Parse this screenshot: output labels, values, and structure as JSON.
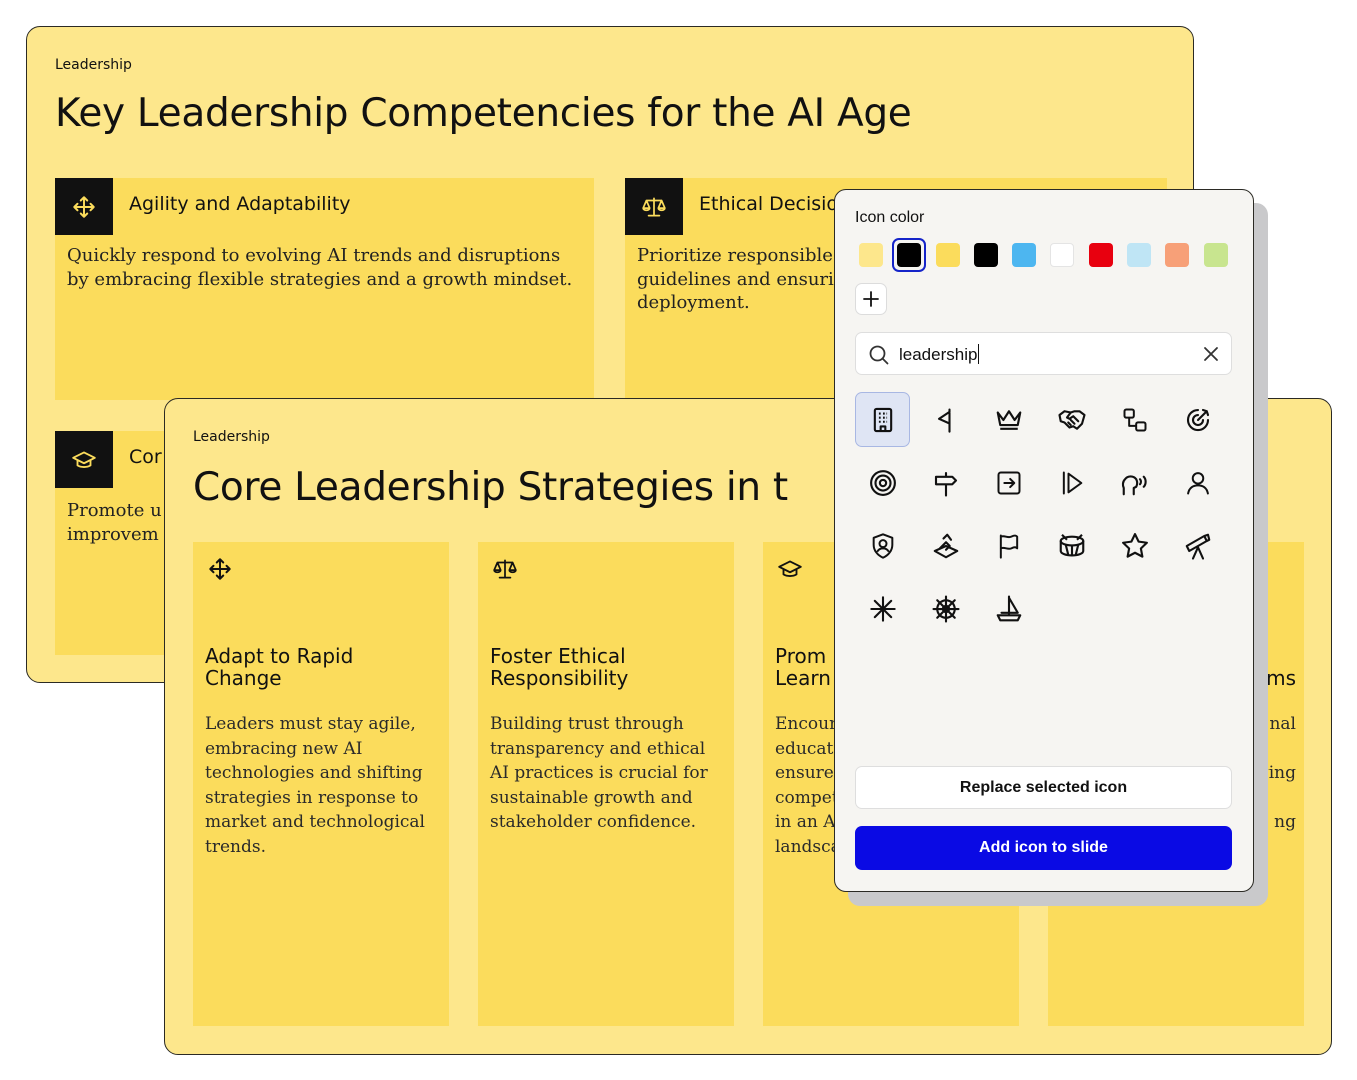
{
  "colors": {
    "slide_bg": "#fde78c",
    "card_bg": "#fbdc5c",
    "primary_button": "#0a0ae4",
    "selected_ring": "#1524c9"
  },
  "back_slide": {
    "eyebrow": "Leadership",
    "title": "Key Leadership Competencies for the AI Age",
    "cards": [
      {
        "icon": "move-arrows-icon",
        "heading": "Agility and Adaptability",
        "body": "Quickly respond to evolving AI trends and disruptions by embracing flexible strategies and a growth mindset."
      },
      {
        "icon": "scales-icon",
        "heading": "Ethical Decisio",
        "body": "Prioritize responsible guidelines and ensuri deployment."
      },
      {
        "icon": "graduation-cap-icon",
        "heading": "Cor",
        "body": "Promote u improvem"
      }
    ]
  },
  "front_slide": {
    "eyebrow": "Leadership",
    "title": "Core Leadership Strategies in t",
    "cards": [
      {
        "icon": "move-arrows-icon",
        "title": "Adapt to Rapid Change",
        "body": "Leaders must stay agile, embracing new AI technologies and shifting strategies in response to market and technological trends."
      },
      {
        "icon": "scales-icon",
        "title": "Foster Ethical Responsibility",
        "body": "Building trust through transparency and ethical AI practices is crucial for sustainable growth and stakeholder confidence."
      },
      {
        "icon": "graduation-cap-icon",
        "title": "Prom\nLearn",
        "body": "Encour\neducati\nensure\ncompet\nin an A\nlandsca"
      },
      {
        "icon": "",
        "title": "\nms",
        "body": "nal\n\nging\n\nng"
      }
    ]
  },
  "icon_panel": {
    "color_label": "Icon color",
    "swatches": [
      {
        "color": "#fde78c",
        "selected": false
      },
      {
        "color": "#000000",
        "selected": true
      },
      {
        "color": "#fbdc5c",
        "selected": false
      },
      {
        "color": "#000000",
        "selected": false
      },
      {
        "color": "#4db6f0",
        "selected": false
      },
      {
        "color": "#ffffff",
        "selected": false
      },
      {
        "color": "#e8000f",
        "selected": false
      },
      {
        "color": "#bfe5f5",
        "selected": false
      },
      {
        "color": "#f7a078",
        "selected": false
      },
      {
        "color": "#c8e58f",
        "selected": false
      }
    ],
    "add_color_icon": "plus-icon",
    "search_value": "leadership",
    "icons": [
      "building-icon",
      "pennant-flag-icon",
      "crown-icon",
      "handshake-icon",
      "hierarchy-icon",
      "target-arrow-icon",
      "bullseye-icon",
      "signpost-icon",
      "arrow-right-box-icon",
      "play-forward-icon",
      "speaking-head-icon",
      "user-icon",
      "shield-user-icon",
      "chess-knight-icon",
      "flag-icon",
      "drum-icon",
      "star-icon",
      "telescope-icon",
      "sparkle-icon",
      "ship-wheel-icon",
      "sailboat-icon"
    ],
    "replace_button": "Replace selected icon",
    "add_button": "Add icon to slide"
  }
}
